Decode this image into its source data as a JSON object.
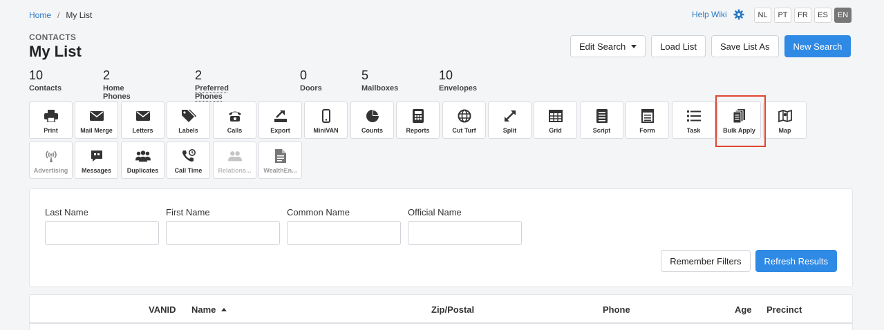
{
  "breadcrumb": {
    "home": "Home",
    "separator": "/",
    "current": "My List"
  },
  "header": {
    "help": "Help Wiki",
    "languages": [
      "NL",
      "PT",
      "FR",
      "ES",
      "EN"
    ],
    "active_language": "EN",
    "kicker": "CONTACTS",
    "title": "My List"
  },
  "actions": {
    "edit_search": "Edit Search",
    "load_list": "Load List",
    "save_list_as": "Save List As",
    "new_search": "New Search"
  },
  "stats": [
    {
      "value": "10",
      "label": "Contacts"
    },
    {
      "value": "2",
      "label": "Home Phones"
    },
    {
      "value": "2",
      "label": "Preferred Phones"
    },
    {
      "value": "0",
      "label": "Doors"
    },
    {
      "value": "5",
      "label": "Mailboxes"
    },
    {
      "value": "10",
      "label": "Envelopes"
    }
  ],
  "tools": {
    "print": "Print",
    "mail_merge": "Mail Merge",
    "letters": "Letters",
    "labels": "Labels",
    "calls": "Calls",
    "export": "Export",
    "minivan": "MiniVAN",
    "counts": "Counts",
    "reports": "Reports",
    "cut_turf": "Cut Turf",
    "split": "Split",
    "grid": "Grid",
    "script": "Script",
    "form": "Form",
    "task": "Task",
    "bulk_apply": "Bulk Apply",
    "map": "Map",
    "advertising": "Advertising",
    "messages": "Messages",
    "duplicates": "Duplicates",
    "call_time": "Call Time",
    "relations": "Relations...",
    "wealth": "WealthEn..."
  },
  "filters": {
    "last_name": {
      "label": "Last Name",
      "value": ""
    },
    "first_name": {
      "label": "First Name",
      "value": ""
    },
    "common_name": {
      "label": "Common Name",
      "value": ""
    },
    "official_name": {
      "label": "Official Name",
      "value": ""
    },
    "remember": "Remember Filters",
    "refresh": "Refresh Results"
  },
  "table": {
    "columns": [
      "VANID",
      "Name",
      "Zip/Postal",
      "Phone",
      "Age",
      "Precinct"
    ]
  },
  "colors": {
    "accent": "#2f8ae5",
    "link": "#2b79c2",
    "highlight": "#e0452f"
  }
}
